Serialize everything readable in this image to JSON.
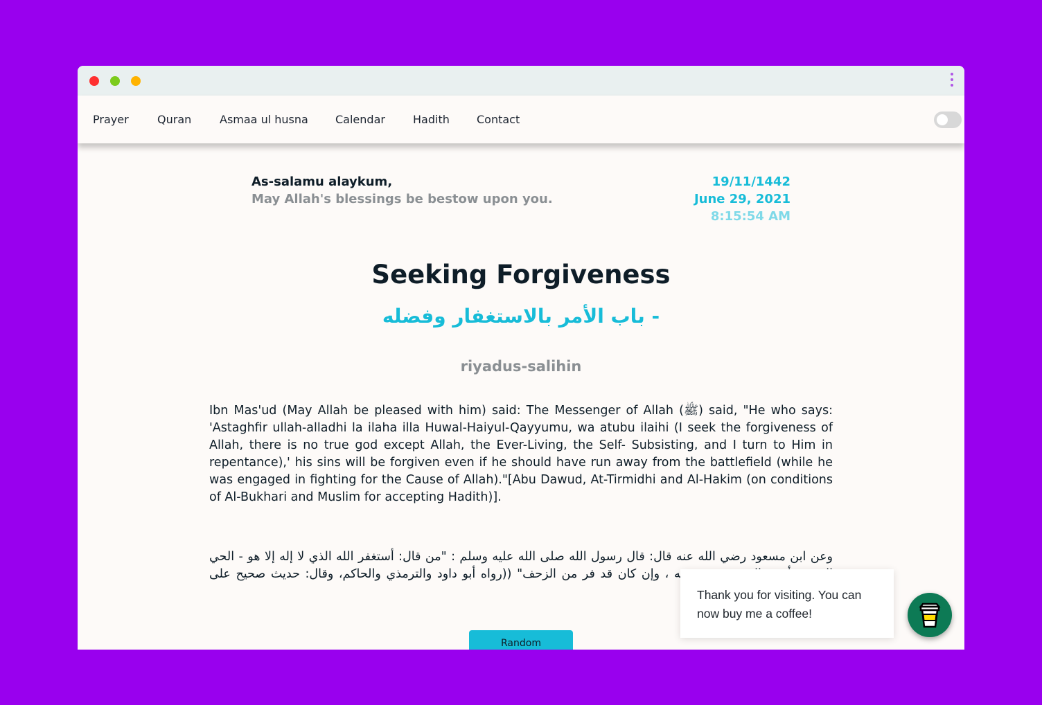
{
  "nav": {
    "items": [
      {
        "label": "Prayer"
      },
      {
        "label": "Quran"
      },
      {
        "label": "Asmaa ul husna"
      },
      {
        "label": "Calendar"
      },
      {
        "label": "Hadith"
      },
      {
        "label": "Contact"
      }
    ],
    "theme_toggle": {
      "state": "off"
    }
  },
  "greeting": {
    "salutation": "As-salamu alaykum,",
    "blessing": "May Allah's blessings be bestow upon you."
  },
  "dates": {
    "hijri": "19/11/1442",
    "gregorian": "June 29, 2021",
    "time": "8:15:54 AM"
  },
  "hadith": {
    "title": "Seeking Forgiveness",
    "arabic_title": "باب الأمر بالاستغفار وفضله -",
    "collection": "riyadus-salihin",
    "english": "Ibn Mas'ud (May Allah be pleased with him) said: The Messenger of Allah (ﷺ) said, \"He who says: 'Astaghfir ullah-alladhi la ilaha illa Huwal-Haiyul-Qayyumu, wa atubu ilaihi (I seek the forgiveness of Allah, there is no true god except Allah, the Ever-Living, the Self- Subsisting, and I turn to Him in repentance),' his sins will be forgiven even if he should have run away from the battlefield (while he was engaged in fighting for the Cause of Allah).\"[Abu Dawud, At-Tirmidhi and Al-Hakim (on conditions of Al-Bukhari and Muslim for accepting Hadith)].",
    "arabic": "وعن ابن مسعود رضي الله عنه قال: قال رسول الله صلى الله عليه وسلم : \"من قال: أستغفر الله الذي لا إله إلا هو - الحي القيوم وأتوب إليه، غفرت ذنوبه ، وإن كان قد فر من الزحف\" ((رواه أبو داود والترمذي والحاكم، وقال: حديث صحيح على شرط البخاري ومسلم))."
  },
  "random_button": {
    "label": "Random"
  },
  "coffee": {
    "message": "Thank you for visiting. You can now buy me a coffee!",
    "icon": "coffee-cup-icon",
    "color": "#0d7a55"
  },
  "colors": {
    "background": "#9900ee",
    "accent": "#17bcd8"
  }
}
